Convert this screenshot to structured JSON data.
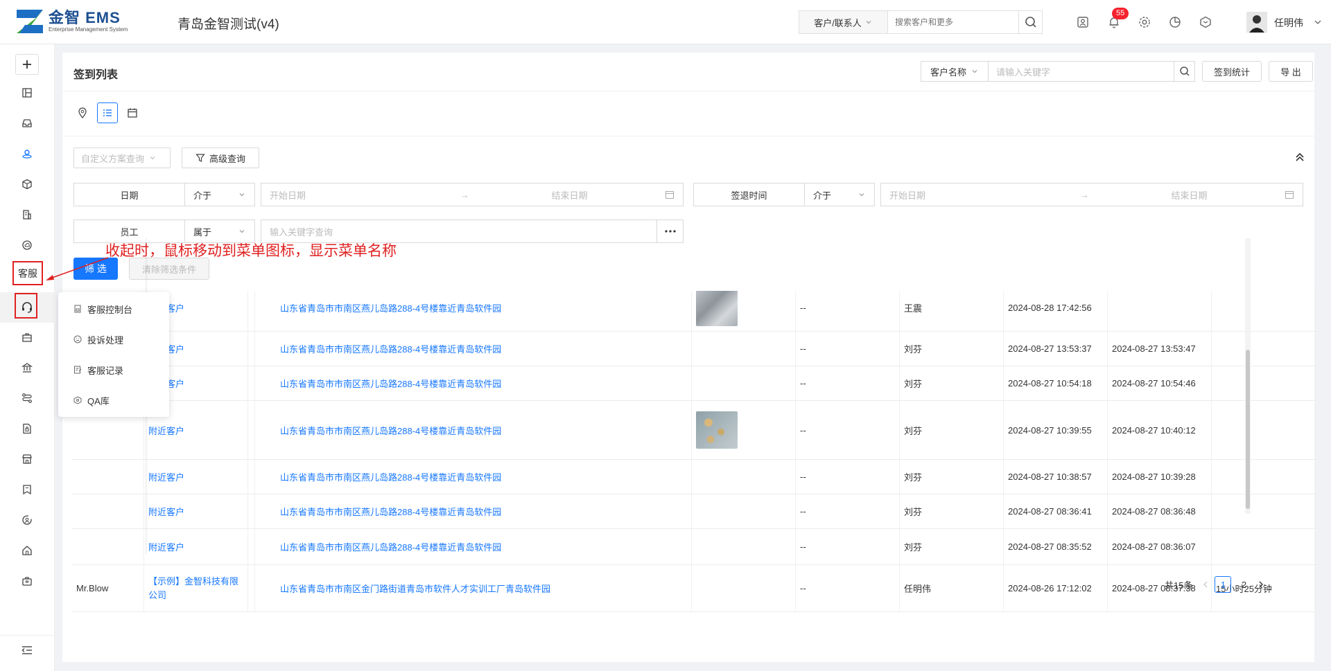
{
  "header": {
    "logo_title": "金智 EMS",
    "logo_subtitle": "Enterprise Management System",
    "company": "青岛金智测试(v4)",
    "search_scope": "客户/联系人",
    "search_placeholder": "搜索客户和更多",
    "notification_count": "55",
    "username": "任明伟"
  },
  "annotation": {
    "label": "客服",
    "note": "收起时，鼠标移动到菜单图标，显示菜单名称"
  },
  "submenu": {
    "items": [
      {
        "label": "客服控制台",
        "icon": "console-icon"
      },
      {
        "label": "投诉处理",
        "icon": "complaint-icon"
      },
      {
        "label": "客服记录",
        "icon": "record-icon"
      },
      {
        "label": "QA库",
        "icon": "qa-icon"
      }
    ]
  },
  "page": {
    "title": "签到列表",
    "search_field": "客户名称",
    "search_placeholder": "请输入关键字",
    "stats_button": "签到统计",
    "export_button": "导 出"
  },
  "filters": {
    "scheme_placeholder": "自定义方案查询",
    "advanced": "高级查询",
    "date_label": "日期",
    "date_op": "介于",
    "start_placeholder": "开始日期",
    "end_placeholder": "结束日期",
    "checkout_label": "签退时间",
    "checkout_op": "介于",
    "employee_label": "员工",
    "employee_op": "属于",
    "keyword_placeholder": "输入关键字查询",
    "filter_button": "筛 选",
    "clear_button": "清除筛选条件",
    "arrow": "→"
  },
  "table": {
    "rows": [
      {
        "c1": "",
        "customer": "附近客户",
        "address": "山东省青岛市市南区燕儿岛路288-4号楼靠近青岛软件园",
        "photo": "photo-1",
        "remark": "--",
        "employee": "王震",
        "checkin": "2024-08-28 17:42:56",
        "checkout": "",
        "duration": ""
      },
      {
        "c1": "",
        "customer": "附近客户",
        "address": "山东省青岛市市南区燕儿岛路288-4号楼靠近青岛软件园",
        "photo": "",
        "remark": "--",
        "employee": "刘芬",
        "checkin": "2024-08-27 13:53:37",
        "checkout": "2024-08-27 13:53:47",
        "duration": ""
      },
      {
        "c1": "",
        "customer": "附近客户",
        "address": "山东省青岛市市南区燕儿岛路288-4号楼靠近青岛软件园",
        "photo": "",
        "remark": "--",
        "employee": "刘芬",
        "checkin": "2024-08-27 10:54:18",
        "checkout": "2024-08-27 10:54:46",
        "duration": ""
      },
      {
        "c1": "",
        "customer": "附近客户",
        "address": "山东省青岛市市南区燕儿岛路288-4号楼靠近青岛软件园",
        "photo": "photo-2",
        "remark": "--",
        "employee": "刘芬",
        "checkin": "2024-08-27 10:39:55",
        "checkout": "2024-08-27 10:40:12",
        "duration": ""
      },
      {
        "c1": "",
        "customer": "附近客户",
        "address": "山东省青岛市市南区燕儿岛路288-4号楼靠近青岛软件园",
        "photo": "",
        "remark": "--",
        "employee": "刘芬",
        "checkin": "2024-08-27 10:38:57",
        "checkout": "2024-08-27 10:39:28",
        "duration": ""
      },
      {
        "c1": "",
        "customer": "附近客户",
        "address": "山东省青岛市市南区燕儿岛路288-4号楼靠近青岛软件园",
        "photo": "",
        "remark": "--",
        "employee": "刘芬",
        "checkin": "2024-08-27 08:36:41",
        "checkout": "2024-08-27 08:36:48",
        "duration": ""
      },
      {
        "c1": "",
        "customer": "附近客户",
        "address": "山东省青岛市市南区燕儿岛路288-4号楼靠近青岛软件园",
        "photo": "",
        "remark": "--",
        "employee": "刘芬",
        "checkin": "2024-08-27 08:35:52",
        "checkout": "2024-08-27 08:36:07",
        "duration": ""
      },
      {
        "c1": "Mr.Blow",
        "customer": "【示例】金智科技有限公司",
        "address": "山东省青岛市市南区金门路街道青岛市软件人才实训工厂青岛软件园",
        "photo": "",
        "remark": "--",
        "employee": "任明伟",
        "checkin": "2024-08-26 17:12:02",
        "checkout": "2024-08-27 08:37:38",
        "duration": "15小时25分钟"
      }
    ]
  },
  "pagination": {
    "total": "共15条",
    "pages": [
      "1",
      "2"
    ]
  },
  "colors": {
    "primary": "#1677ff",
    "annotation": "#e02020",
    "badge": "#f5222d"
  }
}
